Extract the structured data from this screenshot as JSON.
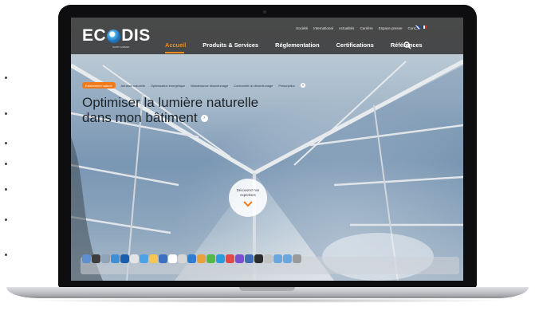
{
  "colors": {
    "accent": "#f18a1e",
    "header_bg": "#404040",
    "pill": "#f07a1a"
  },
  "site": {
    "logo": "ECODIS",
    "logo_tagline": "SAINT-GOBAIN"
  },
  "topnav": [
    "Société",
    "International",
    "Actualités",
    "Carrière",
    "Espace presse",
    "Contact"
  ],
  "mainnav": [
    "Accueil",
    "Produits & Services",
    "Réglementation",
    "Certifications",
    "Références"
  ],
  "subnav": {
    "active": "Eclairement naturel",
    "items": [
      "Aération naturelle",
      "Optimisation énergétique",
      "Maintenance désenfumage",
      "Conformité du désenfumage",
      "Prescription"
    ]
  },
  "hero": {
    "title_line1": "Optimiser la lumière naturelle",
    "title_line2": "dans mon bâtiment",
    "discover_label": "Découvrez nos expertises"
  },
  "icons": {
    "search": "search-icon",
    "close": "close-icon",
    "arrow": "arrow-right-icon",
    "chevron": "chevron-down-icon"
  }
}
